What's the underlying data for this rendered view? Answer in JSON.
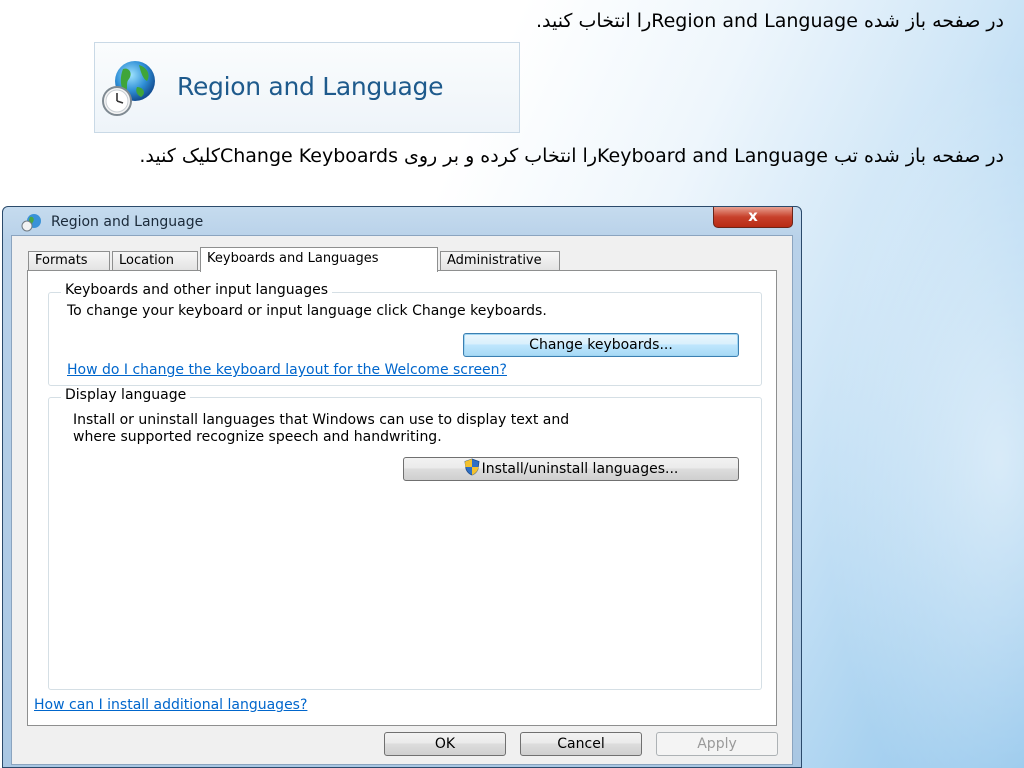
{
  "instructions": {
    "step1": "در صفحه باز شده  Region and Languageرا انتخاب کنید.",
    "step2": "در صفحه باز شده تب  Keyboard and Languageرا انتخاب کرده و بر روی  Change Keyboardsکلیک کنید."
  },
  "control_panel_item": {
    "title": "Region and Language",
    "icon": "globe-clock-icon"
  },
  "window": {
    "title": "Region and Language",
    "close_symbol": "x",
    "tabs": [
      {
        "label": "Formats",
        "active": false
      },
      {
        "label": "Location",
        "active": false
      },
      {
        "label": "Keyboards and Languages",
        "active": true
      },
      {
        "label": "Administrative",
        "active": false
      }
    ],
    "keyboards_group": {
      "label": "Keyboards and other input languages",
      "description": "To change your keyboard or input language click Change keyboards.",
      "button": "Change keyboards...",
      "link": "How do I change the keyboard layout for the Welcome screen?"
    },
    "display_group": {
      "label": "Display language",
      "description_line1": "Install or uninstall languages that Windows can use to display text and",
      "description_line2": "where supported recognize speech and handwriting.",
      "button": "Install/uninstall languages...",
      "button_icon": "uac-shield-icon"
    },
    "bottom_link": "How can I install additional languages?",
    "buttons": {
      "ok": "OK",
      "cancel": "Cancel",
      "apply": "Apply",
      "apply_enabled": false
    }
  },
  "colors": {
    "link": "#0066cc",
    "title_blue": "#1e5a8c",
    "close_red": "#c7402b"
  }
}
